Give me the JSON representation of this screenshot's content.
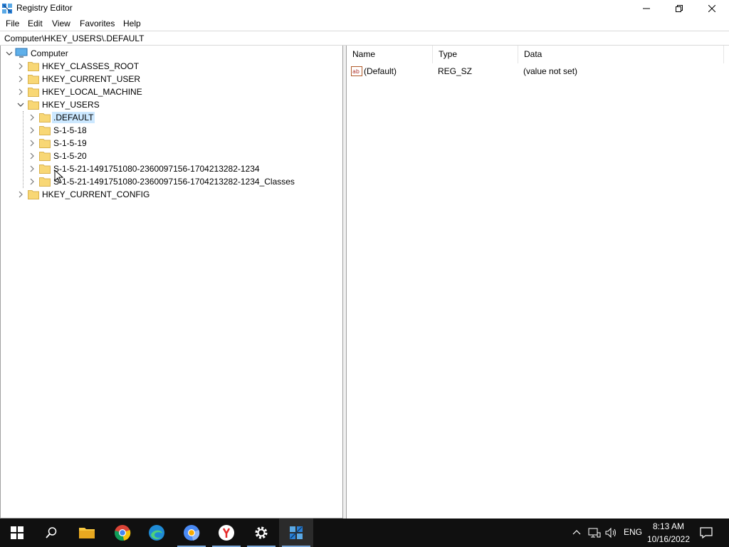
{
  "window": {
    "title": "Registry Editor"
  },
  "menu": [
    "File",
    "Edit",
    "View",
    "Favorites",
    "Help"
  ],
  "address": {
    "value": "Computer\\HKEY_USERS\\.DEFAULT"
  },
  "tree": {
    "root_label": "Computer",
    "nodes": [
      {
        "label": "HKEY_CLASSES_ROOT",
        "depth": 1,
        "expanded": false,
        "selected": false
      },
      {
        "label": "HKEY_CURRENT_USER",
        "depth": 1,
        "expanded": false,
        "selected": false
      },
      {
        "label": "HKEY_LOCAL_MACHINE",
        "depth": 1,
        "expanded": false,
        "selected": false
      },
      {
        "label": "HKEY_USERS",
        "depth": 1,
        "expanded": true,
        "selected": false
      },
      {
        "label": ".DEFAULT",
        "depth": 2,
        "expanded": false,
        "selected": true
      },
      {
        "label": "S-1-5-18",
        "depth": 2,
        "expanded": false,
        "selected": false
      },
      {
        "label": "S-1-5-19",
        "depth": 2,
        "expanded": false,
        "selected": false
      },
      {
        "label": "S-1-5-20",
        "depth": 2,
        "expanded": false,
        "selected": false
      },
      {
        "label": "S-1-5-21-1491751080-2360097156-1704213282-1234",
        "depth": 2,
        "expanded": false,
        "selected": false
      },
      {
        "label": "S-1-5-21-1491751080-2360097156-1704213282-1234_Classes",
        "depth": 2,
        "expanded": false,
        "selected": false
      },
      {
        "label": "HKEY_CURRENT_CONFIG",
        "depth": 1,
        "expanded": false,
        "selected": false
      }
    ]
  },
  "values_list": {
    "columns": [
      "Name",
      "Type",
      "Data"
    ],
    "rows": [
      {
        "icon": "string-value-icon",
        "name": "(Default)",
        "type": "REG_SZ",
        "data": "(value not set)"
      }
    ]
  },
  "taskbar": {
    "apps": [
      "start-icon",
      "search-icon",
      "file-explorer-icon",
      "chrome-icon",
      "edge-icon",
      "chromium-icon",
      "yandex-icon",
      "settings-icon",
      "regedit-icon"
    ],
    "language": "ENG",
    "time": "8:13 AM",
    "date": "10/16/2022"
  },
  "colors": {
    "selection": "#cce8ff",
    "folder": "#f8d775",
    "taskbar": "#101010"
  }
}
